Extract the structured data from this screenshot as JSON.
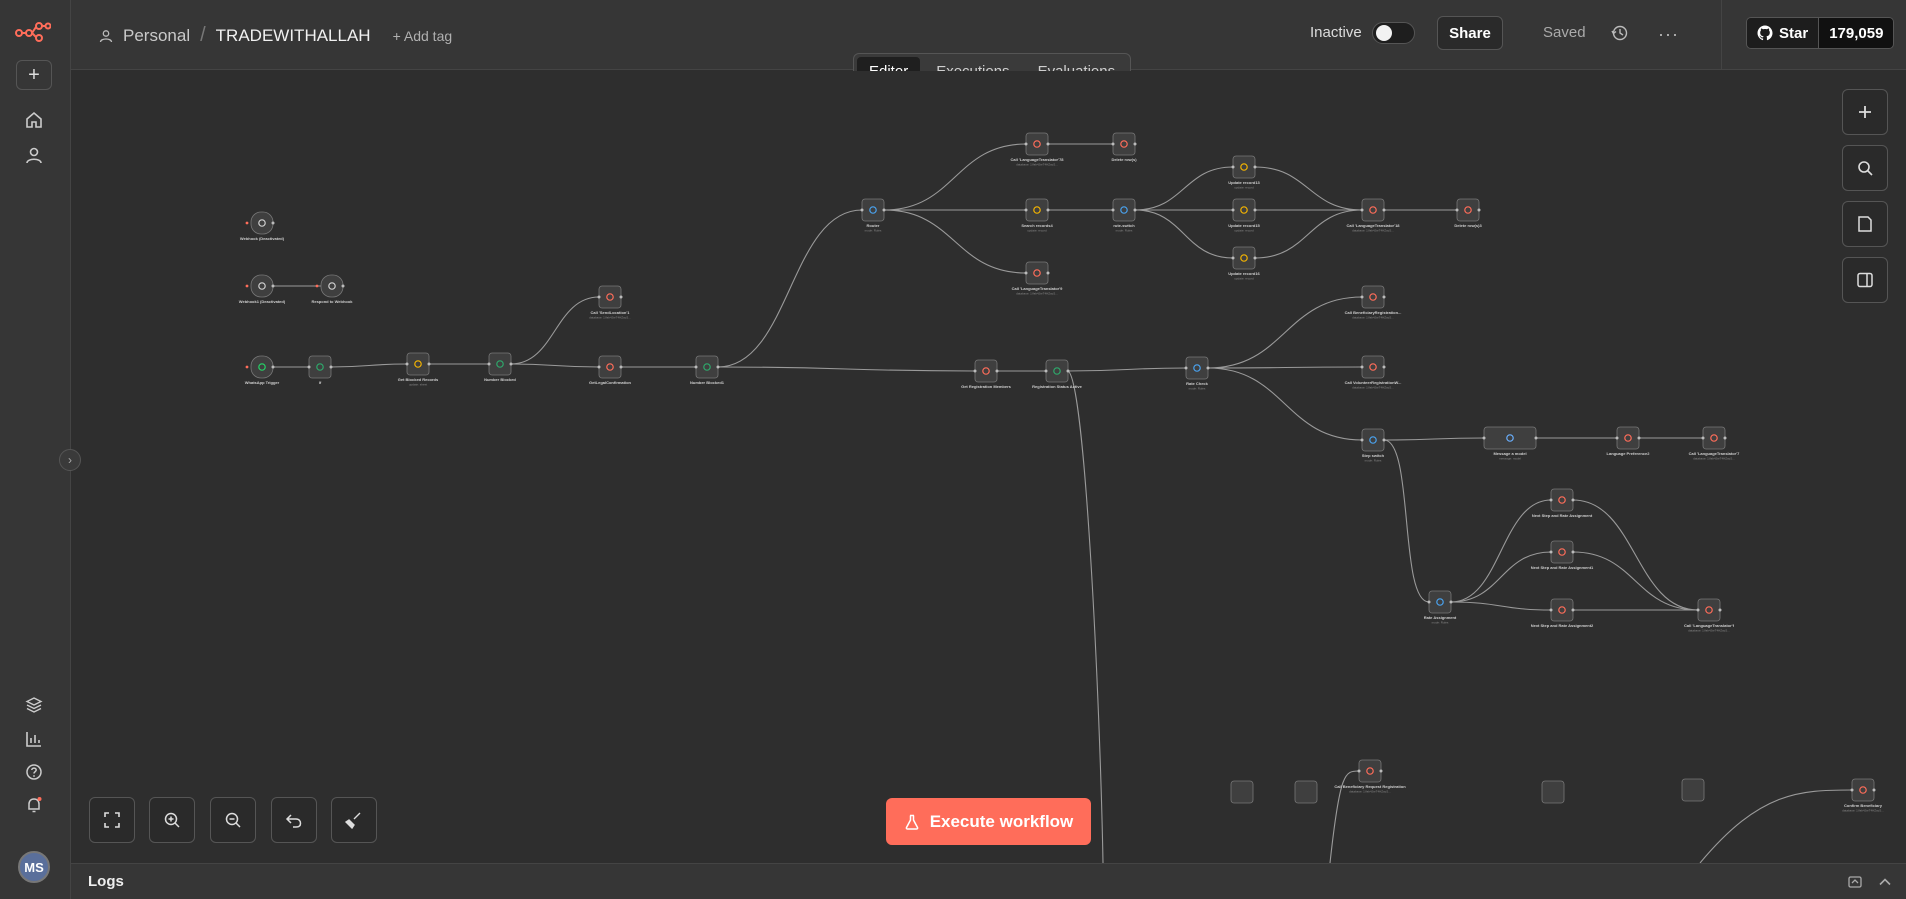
{
  "header": {
    "project": "Personal",
    "workflow_name": "TRADEWITHALLAH",
    "add_tag": "+ Add tag",
    "status_label": "Inactive",
    "share_label": "Share",
    "saved_label": "Saved",
    "star_label": "Star",
    "star_count": "179,059"
  },
  "tabs": [
    {
      "label": "Editor",
      "active": true
    },
    {
      "label": "Executions",
      "active": false
    },
    {
      "label": "Evaluations",
      "active": false
    }
  ],
  "rail": {
    "avatar_initials": "MS"
  },
  "execute_label": "Execute workflow",
  "logs_label": "Logs",
  "colors": {
    "accent": "#ff6d5a",
    "node_bg": "#3f3f3f",
    "edge": "#9a9a9a"
  },
  "nodes": [
    {
      "id": "n_webhook1",
      "label": "Webhook (Deactivated)",
      "sub": "",
      "icon": "webhook-icon"
    },
    {
      "id": "n_webhook2",
      "label": "Webhook1 (Deactivated)",
      "sub": "",
      "icon": "webhook-icon"
    },
    {
      "id": "n_respond",
      "label": "Respond to Webhook",
      "sub": "",
      "icon": "webhook-icon"
    },
    {
      "id": "n_waTrigger",
      "label": "WhatsApp Trigger",
      "sub": "",
      "icon": "whatsapp-icon"
    },
    {
      "id": "n_if",
      "label": "If",
      "sub": "",
      "icon": "if-icon"
    },
    {
      "id": "n_getBlocked",
      "label": "Get Blocked Records",
      "sub": "update: sheet",
      "icon": "sheets-icon"
    },
    {
      "id": "n_numBlocked",
      "label": "Number Blocked",
      "sub": "",
      "icon": "if-icon"
    },
    {
      "id": "n_callSendLocation",
      "label": "Call 'SendLocation'1",
      "sub": "database: 1Vah4JteT4HZacS...",
      "icon": "subworkflow-icon"
    },
    {
      "id": "n_getLegalConfirmation",
      "label": "GetLegalConfirmation",
      "sub": "",
      "icon": "table-icon"
    },
    {
      "id": "n_numBlocked2",
      "label": "Number Blocked1",
      "sub": "",
      "icon": "if-icon"
    },
    {
      "id": "n_router",
      "label": "Router",
      "sub": "mode: Rules",
      "icon": "switch-icon"
    },
    {
      "id": "n_callLang78",
      "label": "Call 'LanguageTranslator'78",
      "sub": "database: 1Vah4JteT4HZacS...",
      "icon": "subworkflow-icon"
    },
    {
      "id": "n_deleteRow",
      "label": "Delete row(s)",
      "sub": "",
      "icon": "table-icon"
    },
    {
      "id": "n_searchRecords",
      "label": "Search records4",
      "sub": "update: record",
      "icon": "sheets-icon"
    },
    {
      "id": "n_routeSwitch",
      "label": "rute-switch",
      "sub": "mode: Rules",
      "icon": "switch-icon"
    },
    {
      "id": "n_update13",
      "label": "Update record13",
      "sub": "update: record",
      "icon": "sheets-icon"
    },
    {
      "id": "n_update15",
      "label": "Update record15",
      "sub": "update: record",
      "icon": "sheets-icon"
    },
    {
      "id": "n_update16",
      "label": "Update record16",
      "sub": "update: record",
      "icon": "sheets-icon"
    },
    {
      "id": "n_callLang18",
      "label": "Call 'LanguageTranslator'18",
      "sub": "database: 1Vah4JteT4HZacS...",
      "icon": "subworkflow-icon"
    },
    {
      "id": "n_callLang9",
      "label": "Call 'LanguageTranslator'9",
      "sub": "database: 1Vah4JteT4HZacS...",
      "icon": "subworkflow-icon"
    },
    {
      "id": "n_deleteRow3",
      "label": "Delete row(s)3",
      "sub": "",
      "icon": "table-icon"
    },
    {
      "id": "n_callBeneficiary",
      "label": "Call BeneficiaryRegistration...",
      "sub": "database: 1Vah4JteT4HZacS...",
      "icon": "subworkflow-icon"
    },
    {
      "id": "n_callVolunteer",
      "label": "Call VolunteerRegistrationW...",
      "sub": "database: 1Vah4JteT4HZacS...",
      "icon": "subworkflow-icon"
    },
    {
      "id": "n_getRegMembers",
      "label": "Get Registration Members",
      "sub": "",
      "icon": "table-icon"
    },
    {
      "id": "n_regStatus",
      "label": "Registration Status Active",
      "sub": "",
      "icon": "if-icon"
    },
    {
      "id": "n_rateCheck",
      "label": "Rate Check",
      "sub": "mode: Rules",
      "icon": "switch-icon"
    },
    {
      "id": "n_stepSwitch",
      "label": "Step switch",
      "sub": "mode: Rules",
      "icon": "switch-icon"
    },
    {
      "id": "n_message",
      "label": "Message a model",
      "sub": "message: model",
      "icon": "ai-icon"
    },
    {
      "id": "n_langPref",
      "label": "Language Preference2",
      "sub": "",
      "icon": "table-icon"
    },
    {
      "id": "n_callLang7",
      "label": "Call 'LanguageTranslator'7",
      "sub": "database: 1Vah4JteT4HZacS...",
      "icon": "subworkflow-icon"
    },
    {
      "id": "n_rateAssignment",
      "label": "Rate Assignment",
      "sub": "mode: Rules",
      "icon": "switch-icon"
    },
    {
      "id": "n_nextStep1",
      "label": "Next Step and Rate Assignment",
      "sub": "",
      "icon": "table-icon"
    },
    {
      "id": "n_nextStep2",
      "label": "Next Step and Rate Assignment1",
      "sub": "",
      "icon": "table-icon"
    },
    {
      "id": "n_nextStep3",
      "label": "Next Step and Rate Assignment2",
      "sub": "",
      "icon": "table-icon"
    },
    {
      "id": "n_callLangF",
      "label": "Call 'LanguageTranslator'f",
      "sub": "database: 1Vah4JteT4HZacS...",
      "icon": "subworkflow-icon"
    },
    {
      "id": "n_callBenReq",
      "label": "Call Beneficiary Request Registration",
      "sub": "database: 1Vah4JteT4HZacS...",
      "icon": "subworkflow-icon"
    },
    {
      "id": "n_confirmBen",
      "label": "Confirm Beneficiary",
      "sub": "database: 1Vah4JteT4HZacS...",
      "icon": "subworkflow-icon"
    }
  ]
}
